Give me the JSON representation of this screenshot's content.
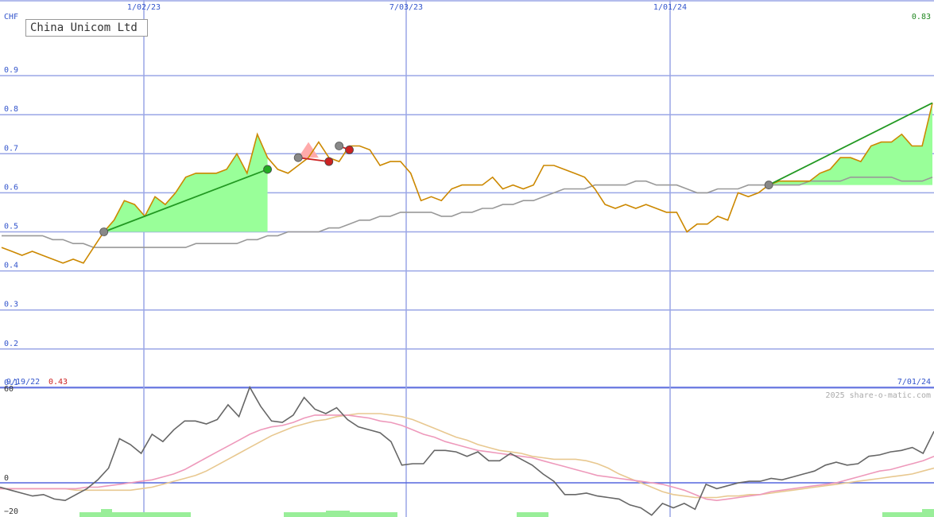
{
  "chart_data": [
    {
      "type": "line",
      "title": "China Unicom Ltd",
      "currency": "CHF",
      "last_value_label": "0.83",
      "start_date": "9/19/22",
      "start_value_label": "0.43",
      "end_date": "7/01/24",
      "x_tick_labels": [
        "1/02/23",
        "7/03/23",
        "1/01/24"
      ],
      "y_tick_labels": [
        "0.9",
        "0.8",
        "0.7",
        "0.6",
        "0.5",
        "0.4",
        "0.3",
        "0.2",
        "0.1"
      ],
      "y_ticks": [
        0.9,
        0.8,
        0.7,
        0.6,
        0.5,
        0.4,
        0.3,
        0.2,
        0.1
      ],
      "ylim": [
        0.0,
        0.98
      ],
      "grid": true,
      "series": [
        {
          "name": "",
          "color": "#cc8800",
          "values": [
            0.46,
            0.45,
            0.44,
            0.45,
            0.44,
            0.43,
            0.42,
            0.43,
            0.42,
            0.46,
            0.5,
            0.53,
            0.58,
            0.57,
            0.54,
            0.59,
            0.57,
            0.6,
            0.64,
            0.65,
            0.65,
            0.65,
            0.66,
            0.7,
            0.65,
            0.75,
            0.69,
            0.66,
            0.65,
            0.67,
            0.69,
            0.73,
            0.69,
            0.68,
            0.72,
            0.72,
            0.71,
            0.67,
            0.68,
            0.68,
            0.65,
            0.58,
            0.59,
            0.58,
            0.61,
            0.62,
            0.62,
            0.62,
            0.64,
            0.61,
            0.62,
            0.61,
            0.62,
            0.67,
            0.67,
            0.66,
            0.65,
            0.64,
            0.61,
            0.57,
            0.56,
            0.57,
            0.56,
            0.57,
            0.56,
            0.55,
            0.55,
            0.5,
            0.52,
            0.52,
            0.54,
            0.53,
            0.6,
            0.59,
            0.6,
            0.62,
            0.63,
            0.63,
            0.63,
            0.63,
            0.65,
            0.66,
            0.69,
            0.69,
            0.68,
            0.72,
            0.73,
            0.73,
            0.75,
            0.72,
            0.72,
            0.83
          ]
        },
        {
          "name": "",
          "color": "#999999",
          "values": [
            0.49,
            0.49,
            0.49,
            0.49,
            0.49,
            0.48,
            0.48,
            0.47,
            0.47,
            0.46,
            0.46,
            0.46,
            0.46,
            0.46,
            0.46,
            0.46,
            0.46,
            0.46,
            0.46,
            0.47,
            0.47,
            0.47,
            0.47,
            0.47,
            0.48,
            0.48,
            0.49,
            0.49,
            0.5,
            0.5,
            0.5,
            0.5,
            0.51,
            0.51,
            0.52,
            0.53,
            0.53,
            0.54,
            0.54,
            0.55,
            0.55,
            0.55,
            0.55,
            0.54,
            0.54,
            0.55,
            0.55,
            0.56,
            0.56,
            0.57,
            0.57,
            0.58,
            0.58,
            0.59,
            0.6,
            0.61,
            0.61,
            0.61,
            0.62,
            0.62,
            0.62,
            0.62,
            0.63,
            0.63,
            0.62,
            0.62,
            0.62,
            0.61,
            0.6,
            0.6,
            0.61,
            0.61,
            0.61,
            0.62,
            0.62,
            0.62,
            0.62,
            0.62,
            0.62,
            0.63,
            0.63,
            0.63,
            0.63,
            0.64,
            0.64,
            0.64,
            0.64,
            0.64,
            0.63,
            0.63,
            0.63,
            0.64
          ]
        }
      ],
      "green_zones": [
        {
          "from": 10,
          "to": 26,
          "base": 0.5
        },
        {
          "from": 75,
          "to": 91,
          "base": 0.62
        }
      ],
      "trend_lines": [
        {
          "x1": 10,
          "y1": 0.5,
          "x2": 26,
          "y2": 0.66,
          "color": "#229922",
          "dot1": "#888888",
          "dot2": "#22aa22"
        },
        {
          "x1": 29,
          "y1": 0.69,
          "x2": 32,
          "y2": 0.68,
          "color": "#cc2222",
          "dot1": "#888888",
          "dot2": "#cc2222"
        },
        {
          "x1": 33,
          "y1": 0.72,
          "x2": 34,
          "y2": 0.71,
          "color": "#cc2222",
          "dot1": "#888888",
          "dot2": "#cc2222"
        },
        {
          "x1": 75,
          "y1": 0.62,
          "x2": 91,
          "y2": 0.83,
          "color": "#229922",
          "dot1": "#888888",
          "dot2": null
        }
      ]
    },
    {
      "type": "line",
      "title": "",
      "y_tick_labels": [
        "60",
        "0",
        "−20"
      ],
      "y_ticks": [
        60,
        0,
        -20
      ],
      "ylim": [
        -27,
        67
      ],
      "watermark": "2025 share-o-matic.com",
      "series": [
        {
          "name": "",
          "color": "#666666",
          "values": [
            -3,
            -5,
            -7,
            -9,
            -8,
            -11,
            -12,
            -8,
            -4,
            2,
            10,
            30,
            26,
            20,
            33,
            28,
            36,
            42,
            42,
            40,
            43,
            53,
            45,
            65,
            52,
            42,
            41,
            46,
            58,
            50,
            47,
            51,
            43,
            38,
            36,
            34,
            28,
            12,
            13,
            13,
            22,
            22,
            21,
            18,
            21,
            15,
            15,
            20,
            16,
            12,
            6,
            1,
            -8,
            -8,
            -7,
            -9,
            -10,
            -11,
            -15,
            -17,
            -22,
            -14,
            -17,
            -14,
            -18,
            -1,
            -4,
            -2,
            0,
            1,
            1,
            3,
            2,
            4,
            6,
            8,
            12,
            14,
            12,
            13,
            18,
            19,
            21,
            22,
            24,
            20,
            35
          ]
        },
        {
          "name": "",
          "color": "#ee99bb",
          "values": [
            -4,
            -4,
            -4,
            -4,
            -4,
            -4,
            -4,
            -4,
            -3,
            -3,
            -2,
            -1,
            0,
            1,
            2,
            4,
            6,
            9,
            13,
            17,
            21,
            25,
            29,
            33,
            36,
            38,
            39,
            41,
            44,
            46,
            46,
            46,
            46,
            45,
            44,
            42,
            41,
            39,
            36,
            33,
            31,
            28,
            26,
            24,
            22,
            21,
            20,
            19,
            18,
            17,
            15,
            13,
            11,
            9,
            7,
            5,
            4,
            3,
            2,
            1,
            0,
            -1,
            -3,
            -5,
            -8,
            -11,
            -12,
            -11,
            -10,
            -9,
            -8,
            -6,
            -5,
            -4,
            -3,
            -2,
            -1,
            0,
            2,
            4,
            6,
            8,
            9,
            11,
            13,
            15,
            18
          ]
        },
        {
          "name": "",
          "color": "#e8c890",
          "values": [
            -4,
            -4,
            -4,
            -4,
            -4,
            -4,
            -4,
            -5,
            -5,
            -5,
            -5,
            -5,
            -5,
            -4,
            -3,
            -1,
            1,
            3,
            5,
            8,
            12,
            16,
            20,
            24,
            28,
            32,
            35,
            38,
            40,
            42,
            43,
            45,
            46,
            47,
            47,
            47,
            46,
            45,
            43,
            40,
            37,
            34,
            31,
            29,
            26,
            24,
            22,
            21,
            20,
            18,
            17,
            16,
            16,
            16,
            15,
            13,
            10,
            6,
            3,
            0,
            -3,
            -6,
            -8,
            -9,
            -10,
            -10,
            -10,
            -9,
            -9,
            -8,
            -8,
            -7,
            -6,
            -5,
            -4,
            -3,
            -2,
            -1,
            0,
            1,
            2,
            3,
            4,
            5,
            6,
            8,
            10
          ]
        }
      ]
    }
  ]
}
